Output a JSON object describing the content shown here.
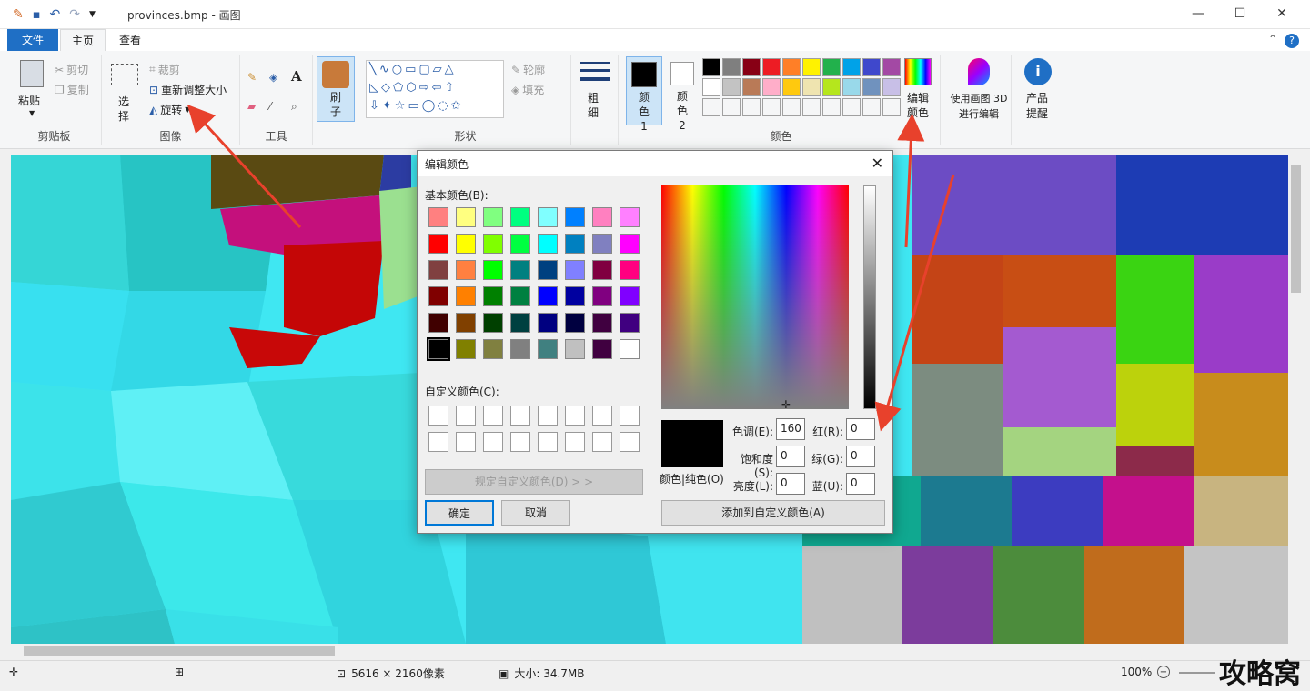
{
  "window": {
    "title": "provinces.bmp - 画图",
    "minimize": "—",
    "maximize": "☐",
    "close": "✕"
  },
  "menu": {
    "file": "文件",
    "home": "主页",
    "view": "查看"
  },
  "ribbon": {
    "clipboard": {
      "paste": "粘贴",
      "cut": "剪切",
      "copy": "复制",
      "label": "剪贴板"
    },
    "image": {
      "select": "选择",
      "crop": "裁剪",
      "resize": "重新调整大小",
      "rotate": "旋转",
      "label": "图像"
    },
    "tools": {
      "label": "工具"
    },
    "brush": {
      "label": "刷子"
    },
    "shapes": {
      "outline": "轮廓",
      "fill": "填充",
      "label": "形状"
    },
    "size": {
      "label": "粗细"
    },
    "colors": {
      "color1": "颜色 1",
      "color2": "颜色 2",
      "edit": "编辑颜色",
      "label": "颜色"
    },
    "paint3d": "使用画图 3D 进行编辑",
    "product_tip": "产品提醒"
  },
  "palette": [
    [
      "#000000",
      "#7f7f7f",
      "#880015",
      "#ed1c24",
      "#ff7f27",
      "#fff200",
      "#22b14c",
      "#00a2e8",
      "#3f48cc",
      "#a349a4"
    ],
    [
      "#ffffff",
      "#c3c3c3",
      "#b97a57",
      "#ffaec9",
      "#ffc90e",
      "#efe4b0",
      "#b5e61d",
      "#99d9ea",
      "#7092be",
      "#c8bfe7"
    ]
  ],
  "dialog": {
    "title": "编辑颜色",
    "basic_label": "基本颜色(B):",
    "custom_label": "自定义颜色(C):",
    "define_custom": "规定自定义颜色(D) > >",
    "ok": "确定",
    "cancel": "取消",
    "solid_label": "颜色|纯色(O)",
    "add_custom": "添加到自定义颜色(A)",
    "hue_label": "色调(E):",
    "hue": "160",
    "sat_label": "饱和度(S):",
    "sat": "0",
    "lum_label": "亮度(L):",
    "lum": "0",
    "red_label": "红(R):",
    "red": "0",
    "green_label": "绿(G):",
    "green": "0",
    "blue_label": "蓝(U):",
    "blue": "0",
    "basic_colors": [
      [
        "#ff8080",
        "#ffff80",
        "#80ff80",
        "#00ff80",
        "#80ffff",
        "#0080ff",
        "#ff80c0",
        "#ff80ff"
      ],
      [
        "#ff0000",
        "#ffff00",
        "#80ff00",
        "#00ff40",
        "#00ffff",
        "#0080c0",
        "#8080c0",
        "#ff00ff"
      ],
      [
        "#804040",
        "#ff8040",
        "#00ff00",
        "#008080",
        "#004080",
        "#8080ff",
        "#800040",
        "#ff0080"
      ],
      [
        "#800000",
        "#ff8000",
        "#008000",
        "#008040",
        "#0000ff",
        "#0000a0",
        "#800080",
        "#8000ff"
      ],
      [
        "#400000",
        "#804000",
        "#004000",
        "#004040",
        "#000080",
        "#000040",
        "#400040",
        "#400080"
      ],
      [
        "#000000",
        "#808000",
        "#808040",
        "#808080",
        "#408080",
        "#c0c0c0",
        "#400040",
        "#ffffff"
      ]
    ]
  },
  "status": {
    "dimensions": "5616 × 2160像素",
    "size": "大小: 34.7MB",
    "zoom": "100%"
  },
  "watermark": "攻略窝"
}
